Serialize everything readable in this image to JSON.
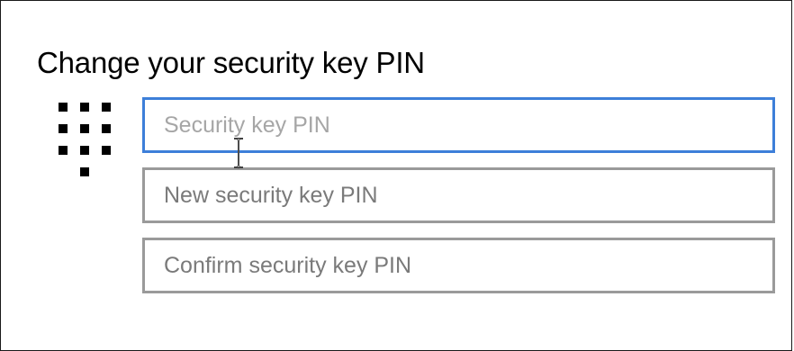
{
  "dialog": {
    "title": "Change your security key PIN",
    "icon": "keypad-icon",
    "fields": {
      "current_pin": {
        "value": "",
        "placeholder": "Security key PIN",
        "focused": true
      },
      "new_pin": {
        "value": "",
        "placeholder": "New security key PIN",
        "focused": false
      },
      "confirm_pin": {
        "value": "",
        "placeholder": "Confirm security key PIN",
        "focused": false
      }
    }
  },
  "colors": {
    "focus_border": "#3d7fd9",
    "field_border": "#9a9a9a",
    "title_text": "#000000"
  },
  "cursor": "text-cursor-icon"
}
